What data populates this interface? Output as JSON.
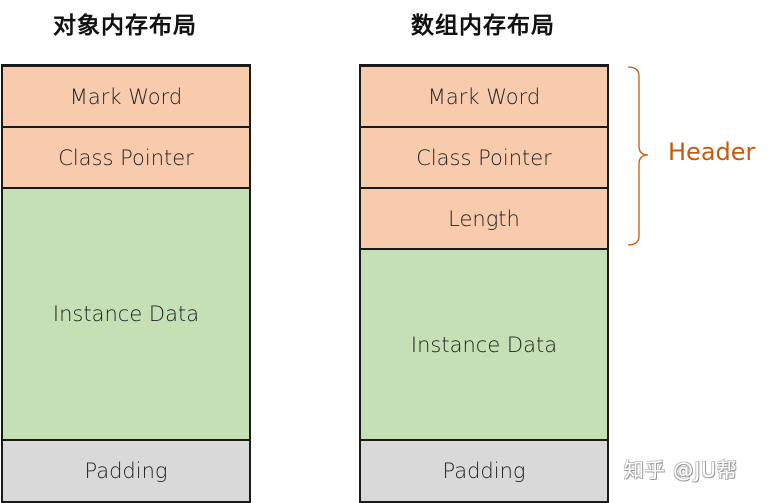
{
  "diagram": {
    "object_layout": {
      "title": "对象内存布局",
      "rows": [
        {
          "label": "Mark Word",
          "kind": "header"
        },
        {
          "label": "Class Pointer",
          "kind": "header"
        },
        {
          "label": "Instance Data",
          "kind": "data"
        },
        {
          "label": "Padding",
          "kind": "padding"
        }
      ]
    },
    "array_layout": {
      "title": "数组内存布局",
      "rows": [
        {
          "label": "Mark Word",
          "kind": "header"
        },
        {
          "label": "Class Pointer",
          "kind": "header"
        },
        {
          "label": "Length",
          "kind": "header"
        },
        {
          "label": "Instance Data",
          "kind": "data"
        },
        {
          "label": "Padding",
          "kind": "padding"
        }
      ]
    },
    "brace_label": "Header",
    "watermark": "知乎 @JU帮",
    "colors": {
      "header": "#f8cbad",
      "data": "#c5e0b4",
      "padding": "#d9d9d9",
      "brace_label": "#c55a11",
      "border": "#1a1a1a"
    }
  }
}
